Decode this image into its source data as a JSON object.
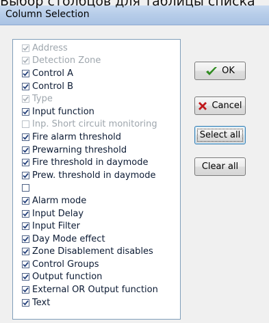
{
  "top_caption": "Выбор столбцов для таблицы списка",
  "window": {
    "title": "Column Selection"
  },
  "columns": [
    {
      "label": "Address",
      "checked": true,
      "enabled": false
    },
    {
      "label": "Detection Zone",
      "checked": true,
      "enabled": false
    },
    {
      "label": "Control A",
      "checked": true,
      "enabled": true
    },
    {
      "label": "Control B",
      "checked": true,
      "enabled": true
    },
    {
      "label": "Type",
      "checked": true,
      "enabled": false
    },
    {
      "label": "Input function",
      "checked": true,
      "enabled": true
    },
    {
      "label": "Inp. Short circuit monitoring",
      "checked": false,
      "enabled": false
    },
    {
      "label": "Fire alarm threshold",
      "checked": true,
      "enabled": true
    },
    {
      "label": "Prewarning threshold",
      "checked": true,
      "enabled": true
    },
    {
      "label": "Fire threshold in daymode",
      "checked": true,
      "enabled": true
    },
    {
      "label": "Prew. threshold in daymode",
      "checked": true,
      "enabled": true
    },
    {
      "label": "",
      "checked": false,
      "enabled": true
    },
    {
      "label": "Alarm mode",
      "checked": true,
      "enabled": true
    },
    {
      "label": "Input Delay",
      "checked": true,
      "enabled": true
    },
    {
      "label": "Input Filter",
      "checked": true,
      "enabled": true
    },
    {
      "label": "Day Mode effect",
      "checked": true,
      "enabled": true
    },
    {
      "label": "Zone Disablement disables",
      "checked": true,
      "enabled": true
    },
    {
      "label": "Control Groups",
      "checked": true,
      "enabled": true
    },
    {
      "label": "Output function",
      "checked": true,
      "enabled": true
    },
    {
      "label": "External OR Output function",
      "checked": true,
      "enabled": true
    },
    {
      "label": "Text",
      "checked": true,
      "enabled": true
    }
  ],
  "buttons": {
    "ok": "OK",
    "cancel": "Cancel",
    "select_all": "Select all",
    "clear_all": "Clear all"
  },
  "colors": {
    "ok_icon": "#2e8b1f",
    "cancel_icon": "#c0181b",
    "check_mark": "#24407a",
    "check_mark_disabled": "#a9b0b8"
  }
}
